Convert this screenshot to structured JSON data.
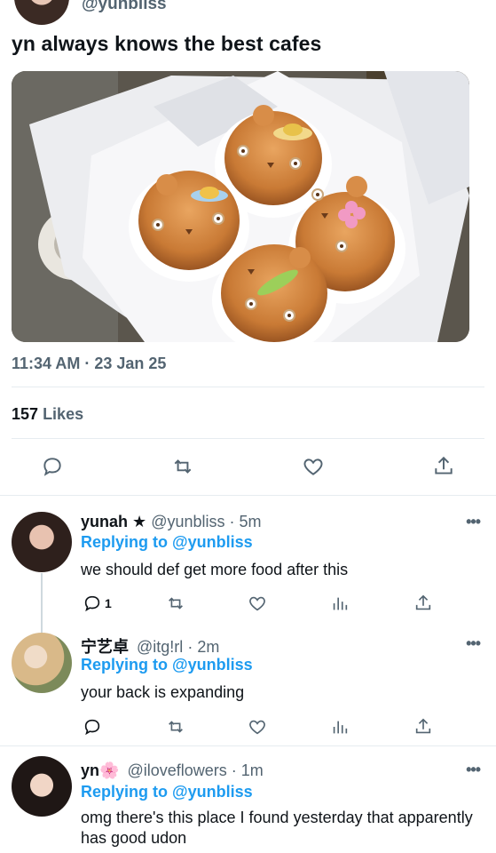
{
  "tweet": {
    "author_handle": "@yunbliss",
    "text": "yn always knows the best cafes",
    "time": "11:34 AM",
    "date": "23 Jan 25",
    "likes_count": "157",
    "likes_label": "Likes"
  },
  "replies": [
    {
      "name": "yunah",
      "badge": "★",
      "handle": "@yunbliss",
      "time": "5m",
      "replying_label": "Replying to",
      "replying_to": "@yunbliss",
      "text": "we should def get more food after this",
      "reply_count": "1"
    },
    {
      "name": "宁艺卓",
      "handle": "@itg!rl",
      "time": "2m",
      "replying_label": "Replying to",
      "replying_to": "@yunbliss",
      "text": "your back is expanding",
      "reply_count": ""
    },
    {
      "name": "yn",
      "badge": "🌸",
      "handle": "@iloveflowers",
      "time": "1m",
      "replying_label": "Replying to",
      "replying_to": "@yunbliss",
      "text": "omg there's this place I found yesterday that apparently has good udon",
      "reply_count": ""
    }
  ],
  "colors": {
    "accent": "#1d9bf0",
    "muted": "#536471",
    "text": "#0f1419",
    "divider": "#e6ecf0"
  },
  "icons": [
    "reply-icon",
    "retweet-icon",
    "like-icon",
    "share-icon",
    "analytics-icon",
    "more-icon"
  ]
}
